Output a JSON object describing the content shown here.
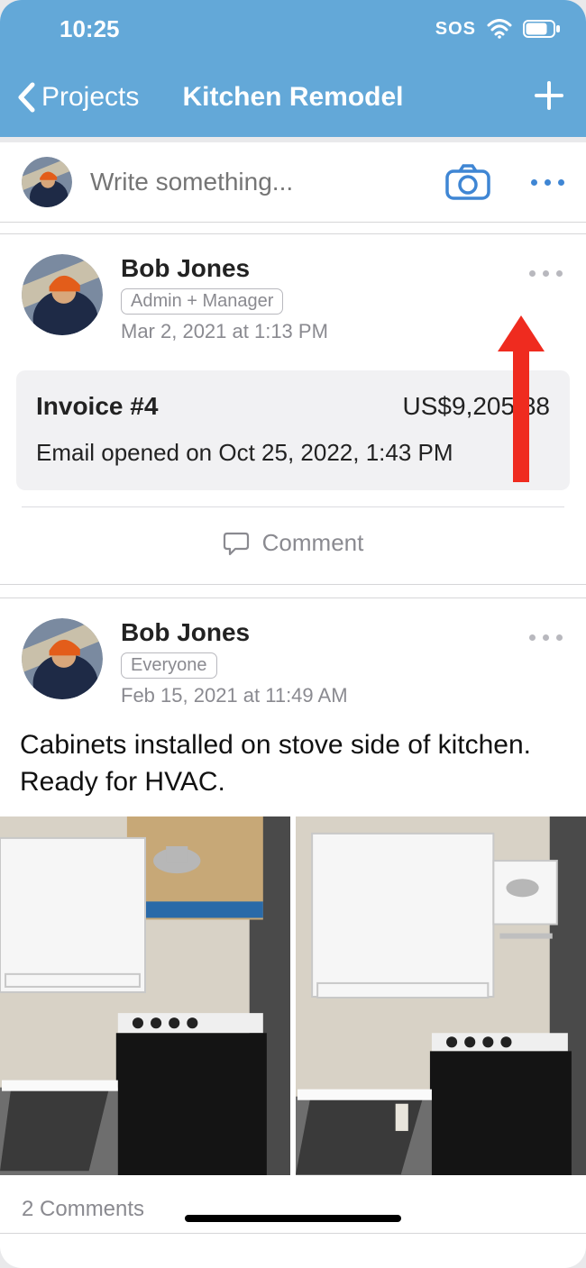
{
  "statusbar": {
    "time": "10:25",
    "sos": "SOS"
  },
  "nav": {
    "back_label": "Projects",
    "title": "Kitchen Remodel"
  },
  "composer": {
    "placeholder": "Write something..."
  },
  "posts": [
    {
      "author": "Bob Jones",
      "role": "Admin + Manager",
      "timestamp": "Mar 2, 2021 at 1:13 PM",
      "invoice": {
        "title": "Invoice #4",
        "amount": "US$9,205.88",
        "status": "Email opened on Oct 25, 2022, 1:43 PM"
      },
      "comment_label": "Comment"
    },
    {
      "author": "Bob Jones",
      "role": "Everyone",
      "timestamp": "Feb 15, 2021 at 11:49 AM",
      "body": "Cabinets installed on stove side of kitchen. Ready for HVAC.",
      "comments_count_label": "2 Comments"
    }
  ]
}
